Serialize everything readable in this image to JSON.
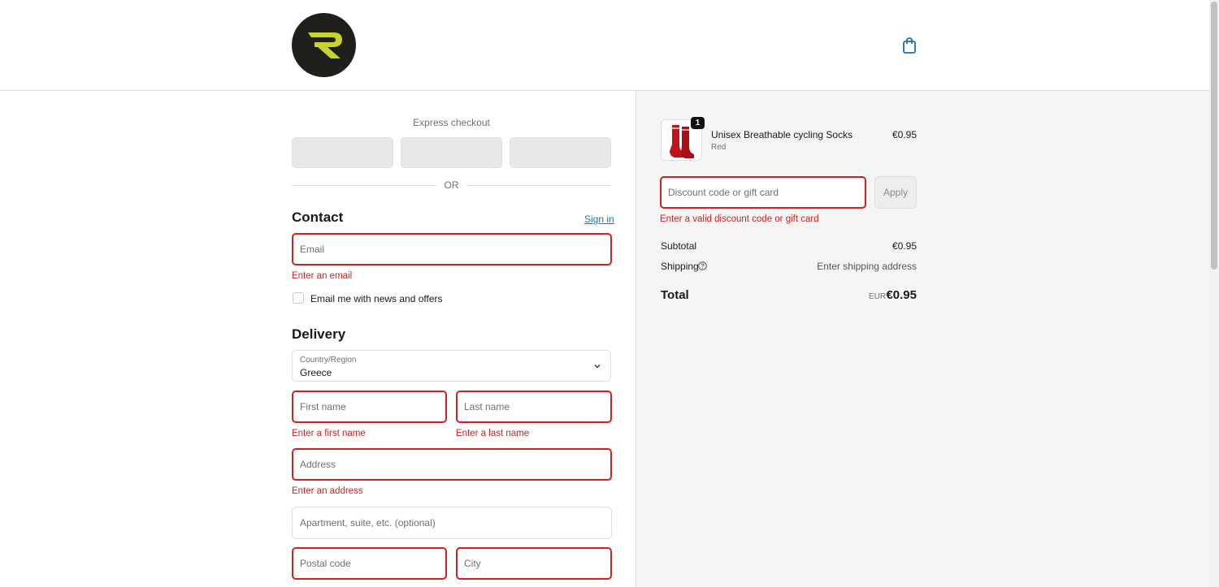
{
  "header": {
    "logo_letter": "R",
    "cart_icon": "shopping-bag-icon"
  },
  "express_checkout": {
    "title": "Express checkout",
    "or_label": "OR"
  },
  "contact": {
    "title": "Contact",
    "sign_in_label": "Sign in",
    "email_placeholder": "Email",
    "email_value": "",
    "email_error": "Enter an email",
    "newsletter_label": "Email me with news and offers",
    "newsletter_checked": false
  },
  "delivery": {
    "title": "Delivery",
    "country_label": "Country/Region",
    "country_value": "Greece",
    "first_name_placeholder": "First name",
    "first_name_error": "Enter a first name",
    "last_name_placeholder": "Last name",
    "last_name_error": "Enter a last name",
    "address_placeholder": "Address",
    "address_error": "Enter an address",
    "apartment_placeholder": "Apartment, suite, etc. (optional)",
    "postal_placeholder": "Postal code",
    "city_placeholder": "City"
  },
  "order": {
    "product_name": "Unisex Breathable cycling Socks",
    "product_variant": "Red",
    "product_price": "€0.95",
    "quantity": "1",
    "discount_placeholder": "Discount code or gift card",
    "discount_error": "Enter a valid discount code or gift card",
    "apply_label": "Apply",
    "subtotal_label": "Subtotal",
    "subtotal_value": "€0.95",
    "shipping_label": "Shipping",
    "shipping_value": "Enter shipping address",
    "total_label": "Total",
    "currency": "EUR",
    "total_value": "€0.95"
  },
  "colors": {
    "error": "#d41f1f",
    "link": "#1773b0",
    "logo_bg": "#1f1f1c",
    "logo_accent": "#c8d230"
  }
}
